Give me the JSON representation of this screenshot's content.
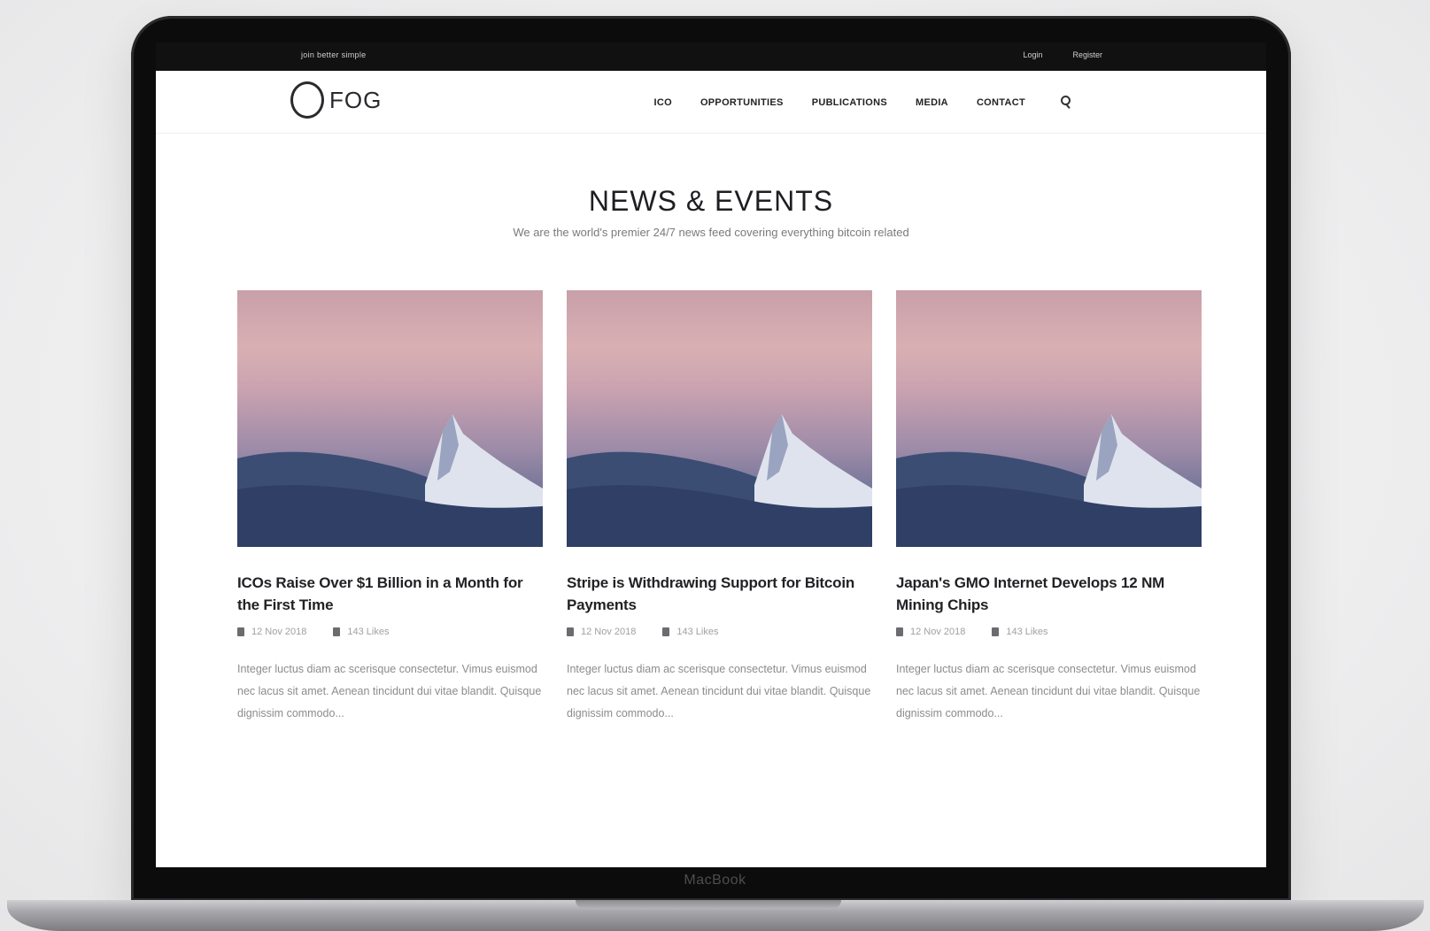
{
  "device": {
    "chin_label": "MacBook"
  },
  "topbar": {
    "left_text": "join better simple",
    "links": [
      "Login",
      "Register"
    ]
  },
  "header": {
    "logo_text": "FOG",
    "nav": [
      "ICO",
      "OPPORTUNITIES",
      "PUBLICATIONS",
      "MEDIA",
      "CONTACT"
    ]
  },
  "section": {
    "title": "NEWS & EVENTS",
    "subtitle": "We are the world's premier 24/7 news feed covering everything bitcoin related"
  },
  "cards": [
    {
      "title": "ICOs Raise Over $1 Billion in a Month for the First Time",
      "date": "12 Nov 2018",
      "comments": "143 Likes",
      "excerpt": "Integer luctus diam ac scerisque consectetur. Vimus euismod nec lacus sit amet. Aenean tincidunt dui vitae blandit. Quisque dignissim commodo..."
    },
    {
      "title": "Stripe is Withdrawing Support for Bitcoin Payments",
      "date": "12 Nov 2018",
      "comments": "143 Likes",
      "excerpt": "Integer luctus diam ac scerisque consectetur. Vimus euismod nec lacus sit amet. Aenean tincidunt dui vitae blandit. Quisque dignissim commodo..."
    },
    {
      "title": "Japan's GMO Internet Develops 12 NM Mining Chips",
      "date": "12 Nov 2018",
      "comments": "143 Likes",
      "excerpt": "Integer luctus diam ac scerisque consectetur. Vimus euismod nec lacus sit amet. Aenean tincidunt dui vitae blandit. Quisque dignissim commodo..."
    }
  ],
  "icons": {
    "search": "search-icon",
    "date": "calendar-icon",
    "likes": "heart-icon"
  }
}
